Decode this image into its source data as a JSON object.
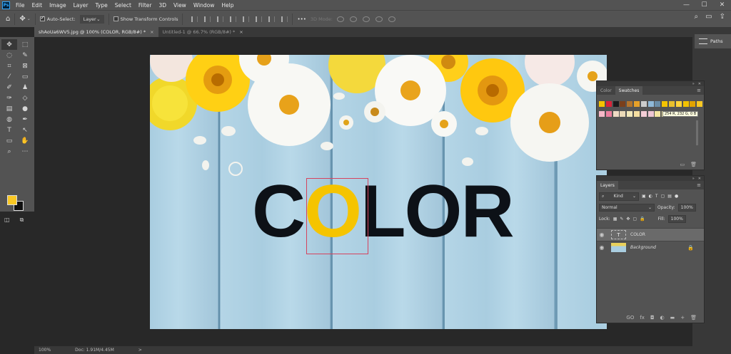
{
  "app": {
    "logo_text": "Ps"
  },
  "menu": [
    "File",
    "Edit",
    "Image",
    "Layer",
    "Type",
    "Select",
    "Filter",
    "3D",
    "View",
    "Window",
    "Help"
  ],
  "window_controls": {
    "minimize": "—",
    "maximize": "☐",
    "close": "✕"
  },
  "options_bar": {
    "auto_select_label": "Auto-Select:",
    "auto_select_value": "Layer",
    "show_transform_label": "Show Transform Controls",
    "more_label": "•••",
    "three_d_label": "3D Mode:"
  },
  "tabs": [
    {
      "label": "shAoUa6WV5.jpg @ 100% (COLOR, RGB/8#) *",
      "close": "×"
    },
    {
      "label": "Untitled-1 @ 66.7% (RGB/8#) *",
      "close": "×"
    }
  ],
  "canvas": {
    "word_before": "C",
    "word_highlight": "O",
    "word_after": "LOR"
  },
  "colors": {
    "foreground": "#f9c824",
    "background": "#111111",
    "accent": "#31a8ff"
  },
  "status": {
    "zoom": "100%",
    "doc": "Doc: 1.91M/4.45M",
    "arrow": ">"
  },
  "dock": {
    "paths_label": "Paths"
  },
  "swatches_panel": {
    "tabs": [
      "Color",
      "Swatches"
    ],
    "row1": [
      "#f5c400",
      "#d8243a",
      "#1b1b1b",
      "#7a3f1b",
      "#b3742c",
      "#e6a028",
      "#cccccc",
      "#8fb9d8",
      "#6b8ea8",
      "#f5c400",
      "#e9c02d",
      "#ffd43b",
      "#f3c200",
      "#e2a300",
      "#f9c824"
    ],
    "row2": [
      "#f7b8c8",
      "#ec7f9f",
      "#eedbc4",
      "#ead9b7",
      "#f0e6b8",
      "#f5dea0",
      "#f3cdd6",
      "#eec6d4",
      "#f5e6a3",
      "#fdf1a6",
      "#f3e48c",
      "#ffe066"
    ],
    "tooltip": "254 R, 232 G, 0 B"
  },
  "layers_panel": {
    "title": "Layers",
    "kind": "Kind",
    "blend_mode": "Normal",
    "opacity_label": "Opacity:",
    "opacity_value": "100%",
    "lock_label": "Lock:",
    "fill_label": "Fill:",
    "fill_value": "100%",
    "layers": [
      {
        "name": "COLOR",
        "type": "text",
        "thumb_label": "T"
      },
      {
        "name": "Background",
        "type": "image"
      }
    ],
    "footer": [
      "GO",
      "fx",
      "◘",
      "◐",
      "▬",
      "+",
      "🗑"
    ]
  }
}
